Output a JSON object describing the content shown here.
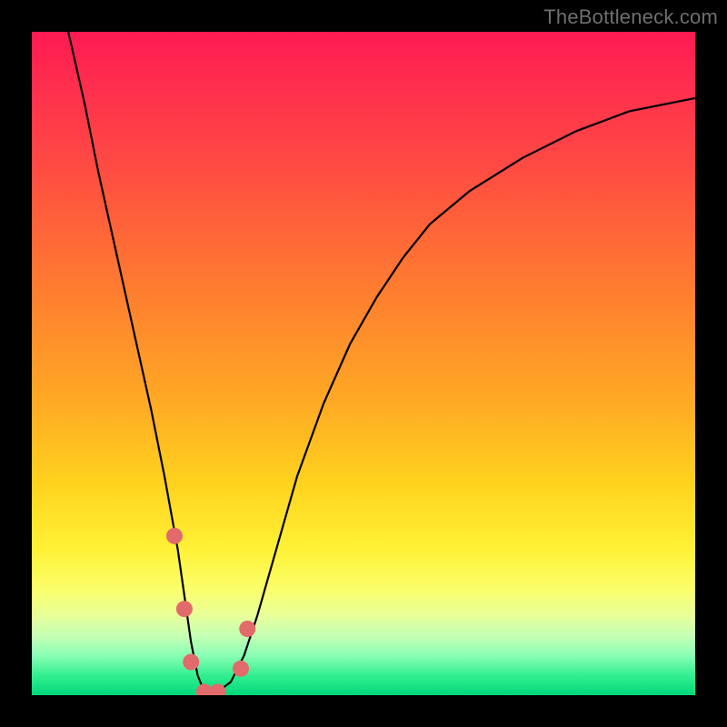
{
  "watermark": "TheBottleneck.com",
  "chart_data": {
    "type": "line",
    "title": "",
    "xlabel": "",
    "ylabel": "",
    "xlim": [
      0,
      100
    ],
    "ylim": [
      0,
      100
    ],
    "grid": false,
    "legend": false,
    "series": [
      {
        "name": "bottleneck-curve",
        "color": "#000000",
        "x": [
          5.5,
          8,
          10,
          12,
          14,
          16,
          18,
          20,
          22,
          23,
          24,
          25,
          26,
          27,
          28,
          30,
          32,
          34,
          36,
          38,
          40,
          44,
          48,
          52,
          56,
          60,
          66,
          74,
          82,
          90,
          100
        ],
        "y": [
          100,
          89,
          79,
          70,
          61,
          52,
          43,
          33,
          22,
          15,
          8,
          3,
          0.5,
          0.2,
          0.5,
          2,
          6,
          12,
          19,
          26,
          33,
          44,
          53,
          60,
          66,
          71,
          76,
          81,
          85,
          88,
          90
        ]
      }
    ],
    "markers": [
      {
        "name": "marker-a",
        "x": 21.5,
        "y": 24,
        "color": "#e26a6a",
        "r": 9
      },
      {
        "name": "marker-b",
        "x": 23.0,
        "y": 13,
        "color": "#e26a6a",
        "r": 9
      },
      {
        "name": "marker-c",
        "x": 24.0,
        "y": 5,
        "color": "#e26a6a",
        "r": 9
      },
      {
        "name": "marker-d",
        "x": 26.0,
        "y": 0.5,
        "color": "#e26a6a",
        "r": 9
      },
      {
        "name": "marker-e",
        "x": 28.0,
        "y": 0.5,
        "color": "#e26a6a",
        "r": 9
      },
      {
        "name": "marker-f",
        "x": 31.5,
        "y": 4,
        "color": "#e26a6a",
        "r": 9
      },
      {
        "name": "marker-g",
        "x": 32.5,
        "y": 10,
        "color": "#e26a6a",
        "r": 9
      }
    ]
  }
}
